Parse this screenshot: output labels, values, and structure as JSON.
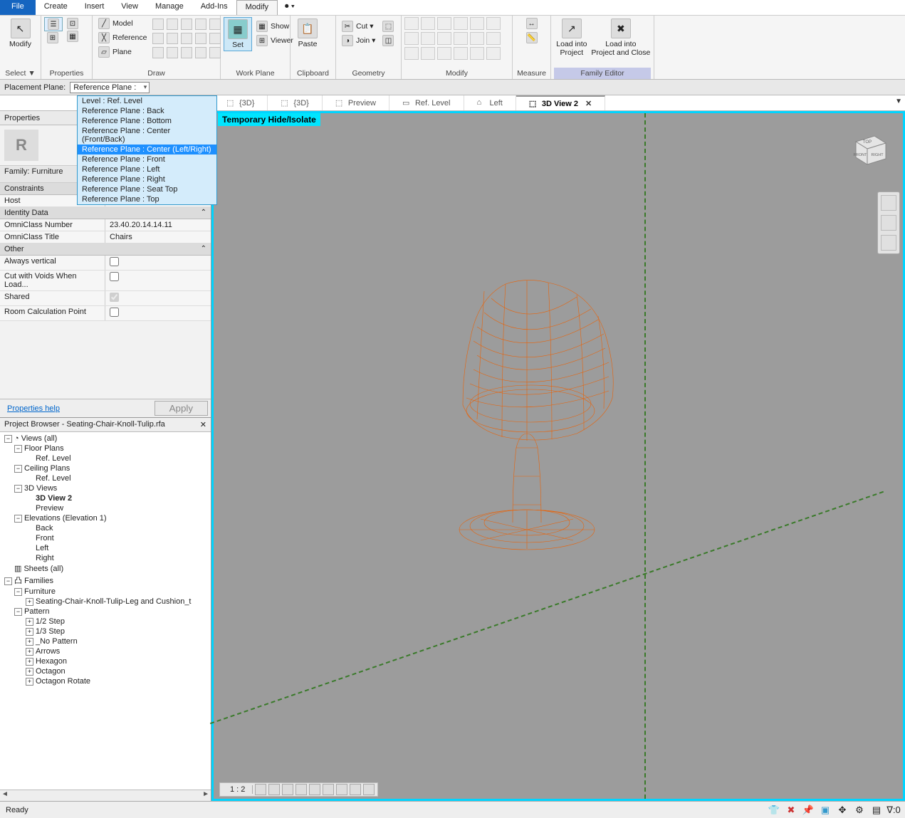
{
  "menubar": {
    "file": "File",
    "items": [
      "Create",
      "Insert",
      "View",
      "Manage",
      "Add-Ins",
      "Modify"
    ],
    "active": "Modify"
  },
  "ribbon": {
    "groups": {
      "select": {
        "label": "Select ▼",
        "modify_label": "Modify"
      },
      "properties": {
        "label": "Properties"
      },
      "draw": {
        "label": "Draw",
        "model": "Model",
        "reference": "Reference",
        "plane_btn": "Plane"
      },
      "workplane": {
        "label": "Work Plane",
        "set": "Set",
        "show": "Show",
        "viewer": "Viewer"
      },
      "clipboard": {
        "label": "Clipboard",
        "paste": "Paste",
        "cut": "Cut ▾",
        "join": "Join ▾"
      },
      "geometry": {
        "label": "Geometry"
      },
      "modify": {
        "label": "Modify"
      },
      "measure": {
        "label": "Measure"
      },
      "family_editor": {
        "label": "Family Editor",
        "load1": "Load into\nProject",
        "load2": "Load into\nProject and Close"
      }
    }
  },
  "options_bar": {
    "label": "Placement Plane:",
    "combo_value": "Reference Plane :"
  },
  "dropdown": {
    "items": [
      "Level : Ref. Level",
      "Reference Plane : Back",
      "Reference Plane : Bottom",
      "Reference Plane : Center (Front/Back)",
      "Reference Plane : Center (Left/Right)",
      "Reference Plane : Front",
      "Reference Plane : Left",
      "Reference Plane : Right",
      "Reference Plane : Seat Top",
      "Reference Plane : Top"
    ],
    "selected_index": 4
  },
  "view_tabs": [
    {
      "label": "{3D}",
      "active": false
    },
    {
      "label": "{3D}",
      "active": false
    },
    {
      "label": "Preview",
      "active": false
    },
    {
      "label": "Ref. Level",
      "active": false
    },
    {
      "label": "Left",
      "active": false
    },
    {
      "label": "3D View 2",
      "active": true
    }
  ],
  "properties": {
    "title": "Properties",
    "family_label": "Family: Furniture",
    "sections": {
      "constraints": {
        "title": "Constraints",
        "rows": [
          {
            "k": "Host",
            "v": ""
          }
        ]
      },
      "identity": {
        "title": "Identity Data",
        "rows": [
          {
            "k": "OmniClass Number",
            "v": "23.40.20.14.14.11"
          },
          {
            "k": "OmniClass Title",
            "v": "Chairs"
          }
        ]
      },
      "other": {
        "title": "Other",
        "rows": [
          {
            "k": "Always vertical",
            "v": "checkbox:false"
          },
          {
            "k": "Cut with Voids When Load...",
            "v": "checkbox:false"
          },
          {
            "k": "Shared",
            "v": "checkbox:true_gray"
          },
          {
            "k": "Room Calculation Point",
            "v": "checkbox:false"
          }
        ]
      }
    },
    "help_link": "Properties help",
    "apply": "Apply"
  },
  "browser": {
    "title": "Project Browser - Seating-Chair-Knoll-Tulip.rfa",
    "tree": [
      {
        "l": 0,
        "t": "-",
        "txt": "Views (all)",
        "icon": "◔"
      },
      {
        "l": 1,
        "t": "-",
        "txt": "Floor Plans"
      },
      {
        "l": 2,
        "t": "",
        "txt": "Ref. Level"
      },
      {
        "l": 1,
        "t": "-",
        "txt": "Ceiling Plans"
      },
      {
        "l": 2,
        "t": "",
        "txt": "Ref. Level"
      },
      {
        "l": 1,
        "t": "-",
        "txt": "3D Views"
      },
      {
        "l": 2,
        "t": "",
        "txt": "3D View 2",
        "bold": true
      },
      {
        "l": 2,
        "t": "",
        "txt": "Preview"
      },
      {
        "l": 1,
        "t": "-",
        "txt": "Elevations (Elevation 1)"
      },
      {
        "l": 2,
        "t": "",
        "txt": "Back"
      },
      {
        "l": 2,
        "t": "",
        "txt": "Front"
      },
      {
        "l": 2,
        "t": "",
        "txt": "Left"
      },
      {
        "l": 2,
        "t": "",
        "txt": "Right"
      },
      {
        "l": 0,
        "t": "",
        "txt": "Sheets (all)",
        "icon": "▥"
      },
      {
        "l": 0,
        "t": "-",
        "txt": "Families",
        "icon": "凸"
      },
      {
        "l": 1,
        "t": "-",
        "txt": "Furniture"
      },
      {
        "l": 2,
        "t": "+",
        "txt": "Seating-Chair-Knoll-Tulip-Leg and Cushion_t"
      },
      {
        "l": 1,
        "t": "-",
        "txt": "Pattern"
      },
      {
        "l": 2,
        "t": "+",
        "txt": "1/2 Step"
      },
      {
        "l": 2,
        "t": "+",
        "txt": "1/3 Step"
      },
      {
        "l": 2,
        "t": "+",
        "txt": "_No Pattern"
      },
      {
        "l": 2,
        "t": "+",
        "txt": "Arrows"
      },
      {
        "l": 2,
        "t": "+",
        "txt": "Hexagon"
      },
      {
        "l": 2,
        "t": "+",
        "txt": "Octagon"
      },
      {
        "l": 2,
        "t": "+",
        "txt": "Octagon Rotate"
      }
    ]
  },
  "viewport": {
    "temp_hide": "Temporary Hide/Isolate",
    "scale": "1 : 2",
    "viewcube": {
      "top": "TOP",
      "front": "FRONT",
      "right": "RIGHT"
    }
  },
  "status": {
    "text": "Ready",
    "filter_count": ":0"
  }
}
